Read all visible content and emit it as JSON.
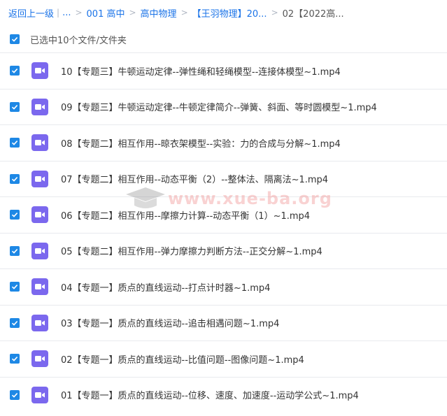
{
  "breadcrumb": {
    "back": "返回上一级",
    "pipe": "|",
    "ellipsis": "...",
    "items": [
      "001 高中",
      "高中物理",
      "【王羽物理】20...",
      "02【2022高..."
    ]
  },
  "selection": {
    "label": "已选中10个文件/文件夹",
    "checked": true
  },
  "files": [
    {
      "name": "10【专题三】牛顿运动定律--弹性绳和轻绳模型--连接体模型~1.mp4",
      "checked": true
    },
    {
      "name": "09【专题三】牛顿运动定律--牛顿定律简介--弹簧、斜面、等时圆模型~1.mp4",
      "checked": true
    },
    {
      "name": "08【专题二】相互作用--晾衣架模型--实验：力的合成与分解~1.mp4",
      "checked": true
    },
    {
      "name": "07【专题二】相互作用--动态平衡（2）--整体法、隔离法~1.mp4",
      "checked": true
    },
    {
      "name": "06【专题二】相互作用--摩擦力计算--动态平衡（1）~1.mp4",
      "checked": true
    },
    {
      "name": "05【专题二】相互作用--弹力摩擦力判断方法--正交分解~1.mp4",
      "checked": true
    },
    {
      "name": "04【专题一】质点的直线运动--打点计时器~1.mp4",
      "checked": true
    },
    {
      "name": "03【专题一】质点的直线运动--追击相遇问题~1.mp4",
      "checked": true
    },
    {
      "name": "02【专题一】质点的直线运动--比值问题--图像问题~1.mp4",
      "checked": true
    },
    {
      "name": "01【专题一】质点的直线运动--位移、速度、加速度--运动学公式~1.mp4",
      "checked": true
    }
  ],
  "icons": {
    "file": "video-file-icon",
    "checkbox": "checkmark-icon"
  },
  "colors": {
    "accent": "#1e88e5",
    "file_icon": "#7b68ee",
    "link": "#1a73e8"
  },
  "watermark": {
    "text": "www.xue-ba.org"
  }
}
